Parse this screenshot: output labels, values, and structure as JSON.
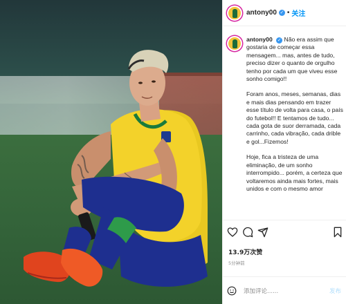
{
  "header": {
    "username": "antony00",
    "separator": "•",
    "follow_label": "关注"
  },
  "caption": {
    "username": "antony00",
    "paragraphs": [
      "Não era assim que gostaria de começar essa mensagem... mas, antes de tudo, preciso dizer o quanto de orgulho tenho por cada um que viveu esse sonho comigo!!",
      "Foram anos, meses, semanas, dias e mais dias pensando em trazer esse título de volta para casa, o país do futebol!! E tentamos de tudo... cada gota de suor derramada, cada carrinho, cada vibração, cada drible e gol...Fizemos!",
      "Hoje, fica a tristeza de uma eliminação, de um sonho interrompido... porém, a certeza que voltaremos ainda mais fortes, mais unidos e com o mesmo amor"
    ]
  },
  "stats": {
    "likes": "13.9万次赞",
    "date": "5分钟前"
  },
  "comment": {
    "placeholder": "添加评论......",
    "post_label": "发布"
  },
  "icons": {
    "like": "heart-icon",
    "comment": "comment-icon",
    "share": "share-icon",
    "save": "bookmark-icon",
    "emoji": "emoji-icon",
    "verified": "verified-badge-icon"
  },
  "colors": {
    "accent": "#0095f6",
    "verified": "#3897f0",
    "jersey": "#f3d22a",
    "shorts": "#1e2f8f",
    "grass": "#34643a"
  }
}
